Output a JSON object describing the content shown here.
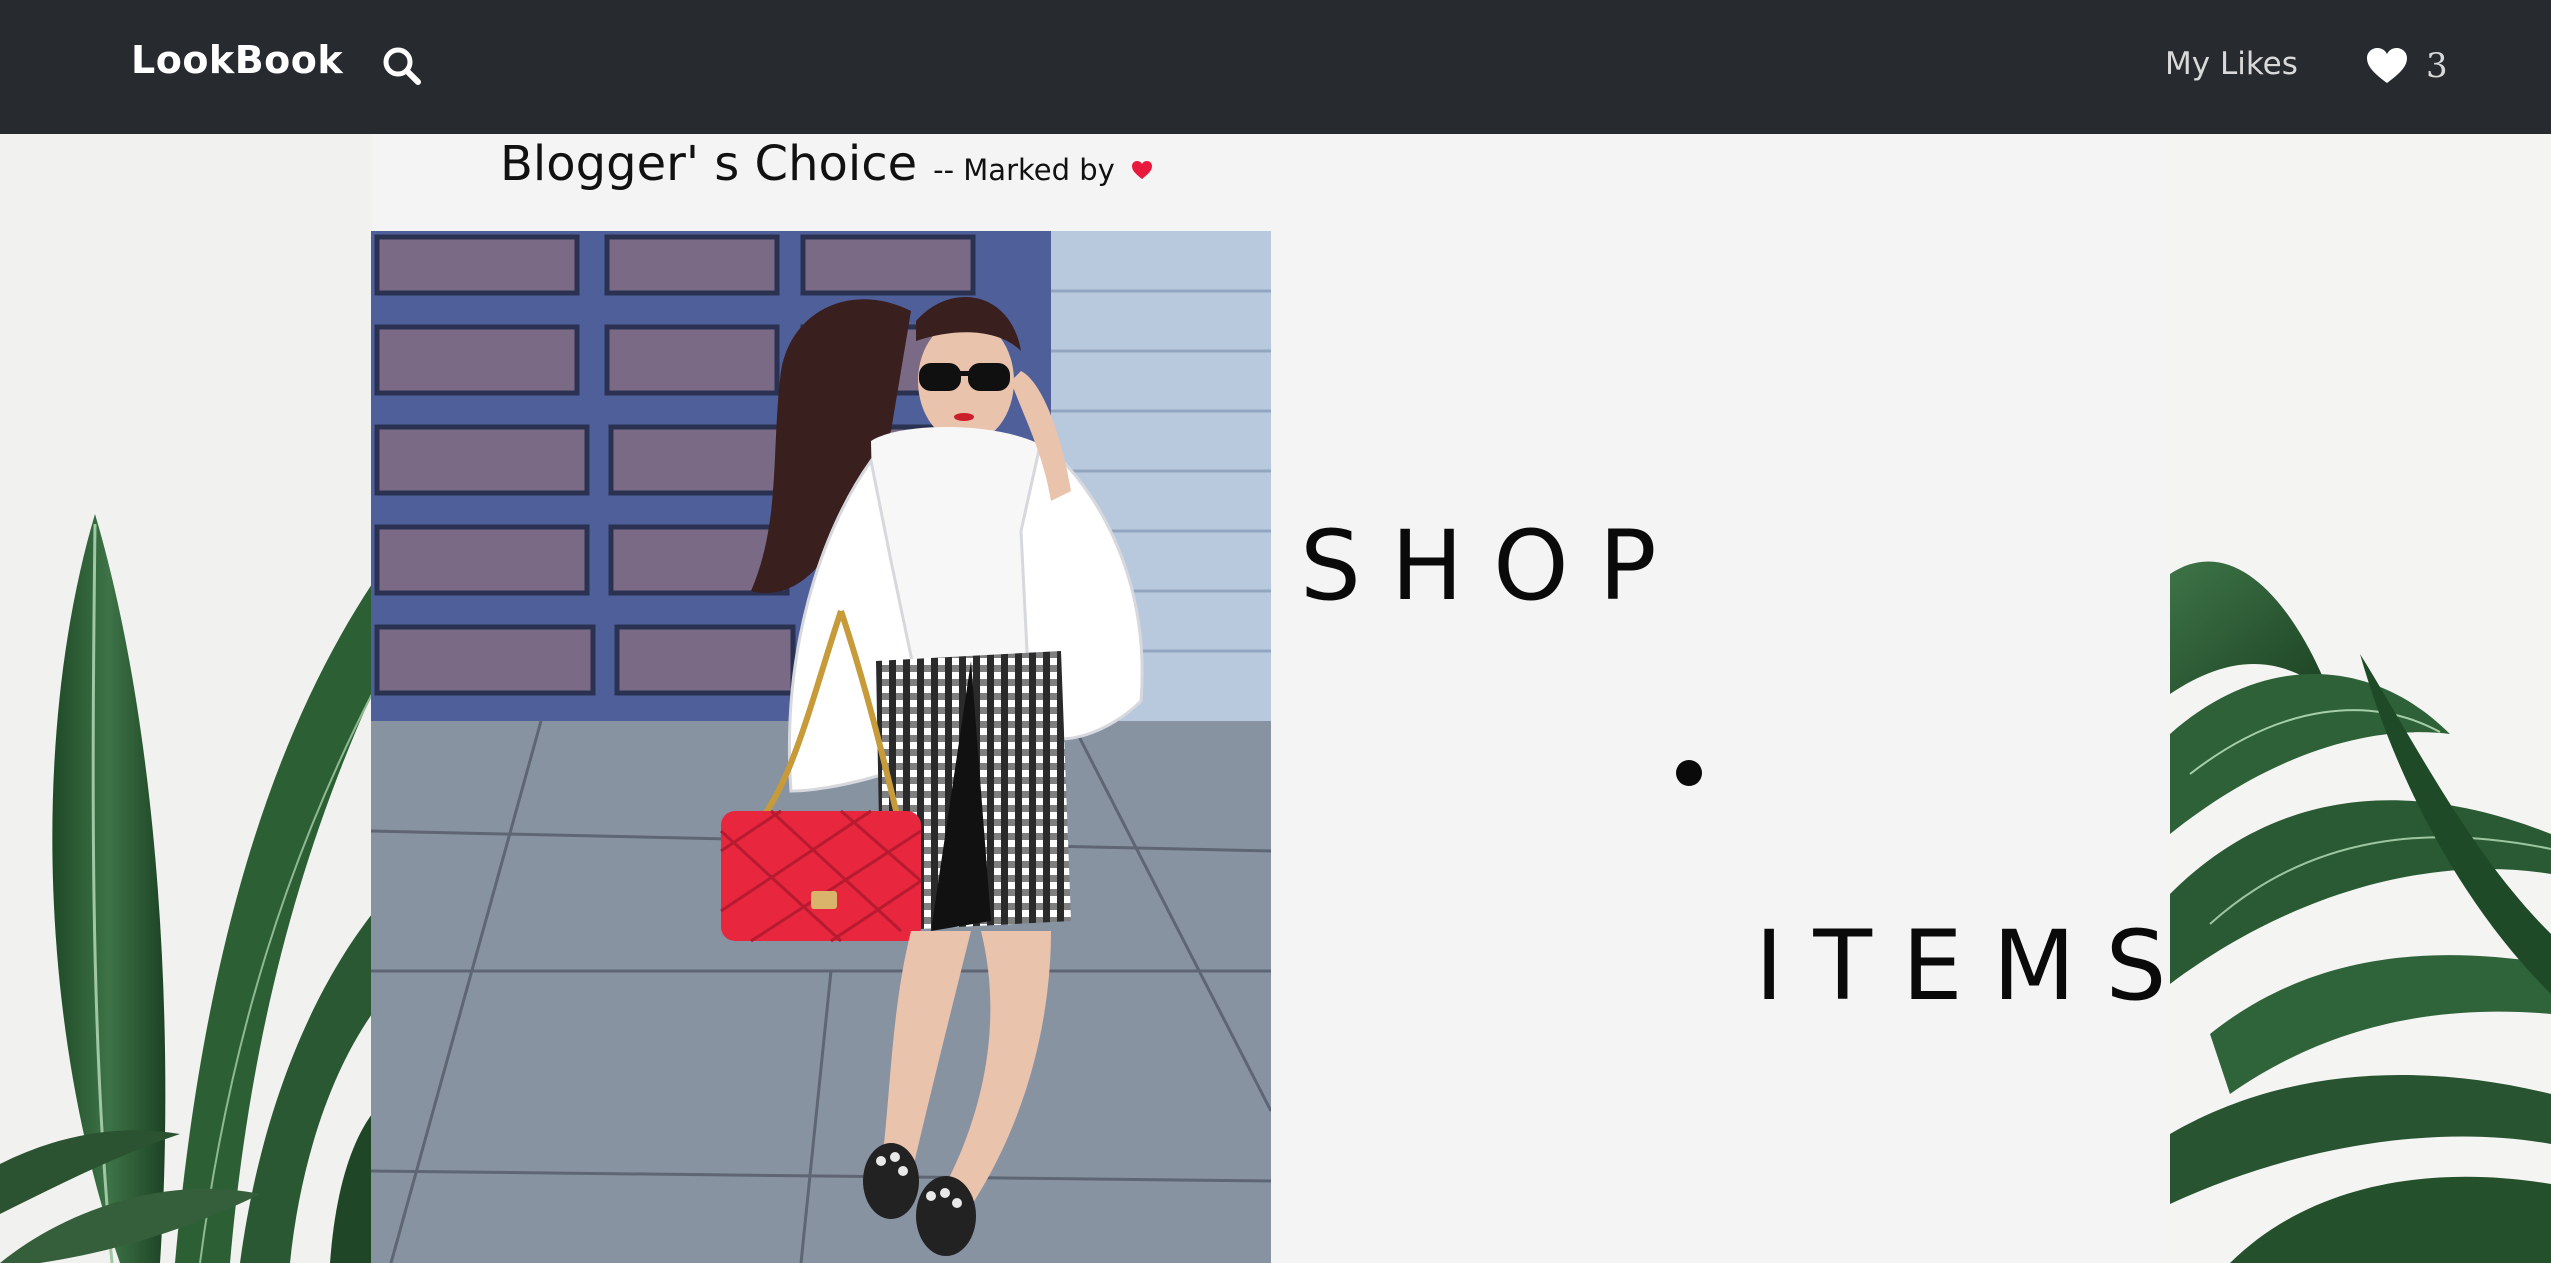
{
  "navbar": {
    "brand": "LookBook",
    "search_icon": "search-icon",
    "my_likes_label": "My Likes",
    "likes_icon": "heart-icon",
    "likes_count": "3"
  },
  "main": {
    "title": "Blogger' s Choice",
    "subtitle": "-- Marked by",
    "marker_icon": "heart-icon",
    "shop_word": "SHOP",
    "items_word": "ITEMS"
  },
  "colors": {
    "navbar_bg": "#272a2f",
    "page_bg": "#f4f4f4",
    "accent_heart": "#e8193c",
    "text_dark": "#0a0a0a",
    "leaf_green": "#2f5e36"
  }
}
